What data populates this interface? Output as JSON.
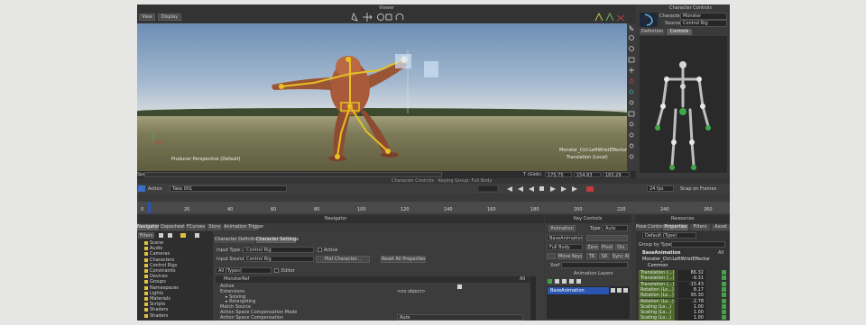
{
  "top": {
    "title": "Viewer",
    "view_menu": "View",
    "display_menu": "Display",
    "character_controls_title": "Character Controls",
    "character_label": "Character",
    "character_value": "Monster",
    "source_label": "Source",
    "source_value": "Control Rig",
    "tabs": [
      "Definition",
      "Controls"
    ]
  },
  "viewport": {
    "camera_label": "Producer Perspective (Default)",
    "selection_label_1": "Monster_Ctrl:LeftWristEffector",
    "selection_label_2": "Translation (Local)"
  },
  "status": {
    "speed_label": "Speed",
    "coord_label": "T (Glob)",
    "coord_x": "175.75",
    "coord_y": "154.83",
    "coord_z": "183.29",
    "mode_text": "Character Controls  ·  Keying Group: Full Body"
  },
  "transport": {
    "action_label": "Action",
    "take_label": "Take 001",
    "fps_value": "24 fps",
    "snap_label": "Snap on Frames"
  },
  "ruler": {
    "ticks": [
      "0",
      "20",
      "40",
      "60",
      "80",
      "100",
      "120",
      "140",
      "160",
      "180",
      "200",
      "220",
      "240",
      "260"
    ]
  },
  "navigator": {
    "title": "Navigator",
    "tabs": [
      "Navigator",
      "Dopesheet",
      "FCurves",
      "Story",
      "Animation Trigger"
    ],
    "filter_label": "Filters",
    "tree": [
      "Scene",
      "Audio",
      "Cameras",
      "Characters",
      "Control Rigs",
      "Constraints",
      "Devices",
      "Groups",
      "Namespaces",
      "Lights",
      "Materials",
      "Scripts",
      "Shaders",
      "Shaders"
    ]
  },
  "character": {
    "tabs": [
      "Character Definition",
      "Character Settings"
    ],
    "input_type_label": "Input Type :",
    "input_type_value": "Control Rig",
    "active_label": "Active",
    "input_source_label": "Input Source :",
    "input_source_value": "Control Rig",
    "plot_button": "Plot Character...",
    "reset_button": "Reset All Properties",
    "properties_filter": "All (Types)",
    "editor_label": "Editor",
    "section": "MonsterRef",
    "rows": [
      "Active",
      "Extensions",
      "Solving",
      "Retargeting",
      "Match Source",
      "Action Space Compensation Mode",
      "Action Space Compensation"
    ],
    "extensions_value": "<no object>",
    "compensation_mode_value": "Auto",
    "all_label": "All"
  },
  "key_controls": {
    "title": "Key Controls",
    "animation_label": "Animation",
    "type_label": "Type",
    "type_value": "Auto",
    "layer_value": "BaseAnimation",
    "keying_value": "Full Body",
    "buttons": [
      "Zero",
      "Pivot",
      "Dis."
    ],
    "more_buttons": [
      "Move Keys",
      "TR",
      "SR",
      "Sync All"
    ],
    "xref_label": "Xref",
    "animation_layers_title": "Animation Layers",
    "layer_name": "BaseAnimation"
  },
  "resources": {
    "title": "Resources",
    "tabs": [
      "Pose Controls",
      "Properties",
      "Filters",
      "Asset"
    ],
    "object_field": "Default (Type)",
    "group_label": "Group by Type",
    "tree_root": "BaseAnimation",
    "tree_child": "Monster_Ctrl:LeftWristEffector",
    "common_label": "Common",
    "all_label": "All",
    "values": [
      {
        "label": "Translation (...)",
        "value": "86.32"
      },
      {
        "label": "Translation (...)",
        "value": "-9.31"
      },
      {
        "label": "Translation (...)",
        "value": "-15.43"
      },
      {
        "label": "Rotation (Lo...)",
        "value": "8.17"
      },
      {
        "label": "Rotation (Lo...)",
        "value": "95.30"
      },
      {
        "label": "Rotation (Lo...)",
        "value": "-2.78"
      },
      {
        "label": "Scaling (Lo...)",
        "value": "1.00"
      },
      {
        "label": "Scaling (Lo...)",
        "value": "1.00"
      },
      {
        "label": "Scaling (Lo...)",
        "value": "1.00"
      }
    ]
  },
  "colors": {
    "accent_blue": "#3a6fc4",
    "bone_yellow": "#e8c020",
    "selection_green": "#48a048"
  }
}
